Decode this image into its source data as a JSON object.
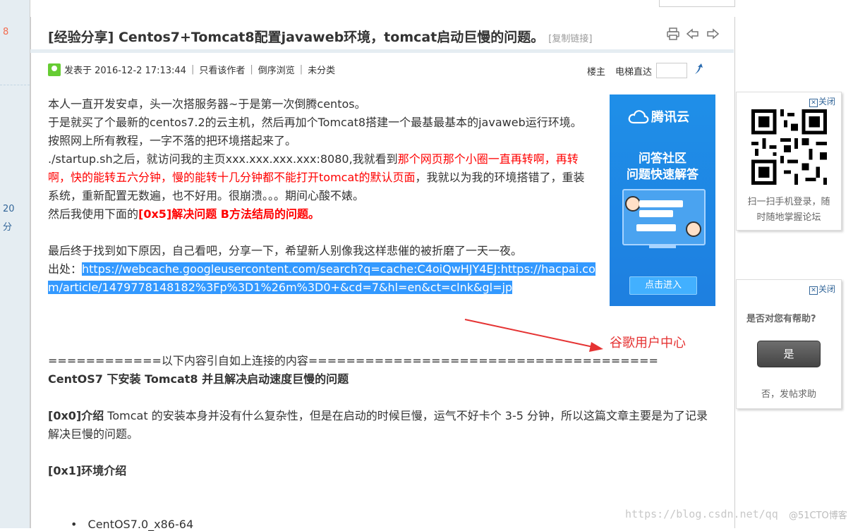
{
  "left_strip": {
    "num_top": "8",
    "num_mid": "20",
    "num_mid_unit": "分"
  },
  "post": {
    "title": "[经验分享] Centos7+Tomcat8配置javaweb环境，tomcat启动巨慢的问题。",
    "copy_link": "[复制链接]",
    "meta": {
      "posted": "发表于 2016-12-2 17:13:44",
      "only_author": "只看该作者",
      "reverse": "倒序浏览",
      "category": "未分类",
      "floor_owner": "楼主",
      "elevator": "电梯直达"
    },
    "body": {
      "p1": "本人一直开发安卓，头一次搭服务器~于是第一次倒腾centos。",
      "p2": "于是就买了个最新的centos7.2的云主机，然后再加个Tomcat8搭建一个最基最基本的javaweb运行环境。",
      "p3": "按照网上所有教程，一字不落的把环境搭起来了。",
      "p4a": "./startup.sh之后，就访问我的主页xxx.xxx.xxx.xxx:8080,我就看到",
      "p4red": "那个网页那个小圈一直再转啊，再转啊，快的能转五六分钟，慢的能转十几分钟都不能打开tomcat的默认页面",
      "p4b": "，我就以为我的环境搭错了，重装系统，重新配置无数遍，也不好用。很崩溃。。。期间心酸不婊。",
      "p5a": "然后我使用下面的",
      "p5red": "[0x5]解决问题 B方法结局的问题。",
      "p6": "最后终于找到如下原因，自己看吧，分享一下，希望新人别像我这样悲催的被折磨了一天一夜。",
      "source_label": "出处：",
      "source_link": "https://webcache.googleusercontent.com/search?q=cache:C4oiQwHJY4EJ:https://hacpai.com/article/1479778148182%3Fp%3D1%26m%3D0+&cd=7&hl=en&ct=clnk&gl=jp",
      "divider": "============以下内容引自如上连接的内容=====================================",
      "heading1": "CentOS7 下安装 Tomcat8 并且解决启动速度巨慢的问题",
      "intro_label": "[0x0]介绍",
      "intro_text": " Tomcat 的安装本身并没有什么复杂性，但是在启动的时候巨慢，运气不好卡个 3-5 分钟，所以这篇文章主要是为了记录解决巨慢的问题。",
      "env_label": "[0x1]环境介绍",
      "list_item1": "CentOS7.0_x86-64"
    }
  },
  "ad": {
    "brand": "腾讯云",
    "line1": "问答社区",
    "line2": "问题快速解答",
    "button": "点击进入",
    "accent": "#1e88e5"
  },
  "side_qr": {
    "close": "关闭",
    "caption1": "扫一扫手机登录，随",
    "caption2": "时随地掌握论坛"
  },
  "side_help": {
    "close": "关闭",
    "question": "是否对您有帮助?",
    "yes": "是",
    "no": "否，发帖求助"
  },
  "annotation": {
    "text": "谷歌用户中心",
    "color": "#e53333"
  },
  "watermark": {
    "url": "https://blog.csdn.net/qq",
    "brand": "@51CTO博客"
  }
}
